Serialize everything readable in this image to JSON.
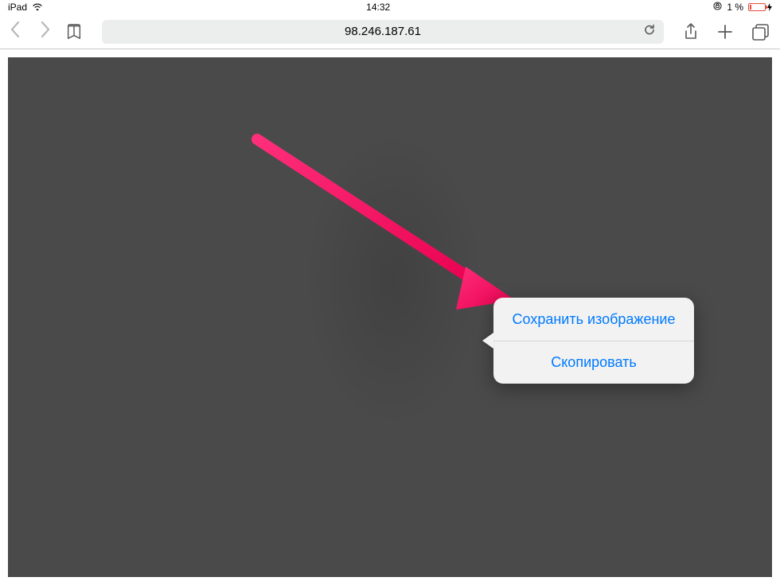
{
  "status": {
    "device": "iPad",
    "time": "14:32",
    "battery_pct": "1 %"
  },
  "toolbar": {
    "address": "98.246.187.61"
  },
  "popover": {
    "save_image": "Сохранить изображение",
    "copy": "Скопировать"
  },
  "colors": {
    "link_blue": "#007aff",
    "arrow_pink": "#ee1c66"
  }
}
